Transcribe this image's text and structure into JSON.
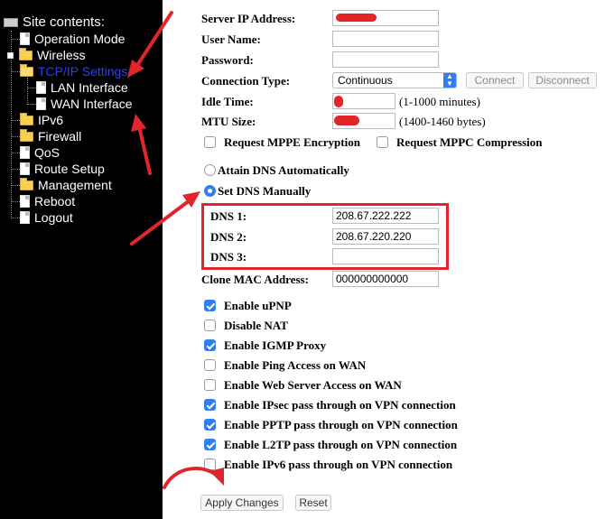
{
  "sidebar": {
    "title": "Site contents:",
    "items": [
      {
        "label": "Operation Mode"
      },
      {
        "label": "Wireless"
      },
      {
        "label": "TCP/IP Settings"
      },
      {
        "label": "LAN Interface"
      },
      {
        "label": "WAN Interface"
      },
      {
        "label": "IPv6"
      },
      {
        "label": "Firewall"
      },
      {
        "label": "QoS"
      },
      {
        "label": "Route Setup"
      },
      {
        "label": "Management"
      },
      {
        "label": "Reboot"
      },
      {
        "label": "Logout"
      }
    ],
    "active_color": "#2c3cff"
  },
  "form": {
    "server_ip_label": "Server IP Address:",
    "username_label": "User Name:",
    "password_label": "Password:",
    "connection_type_label": "Connection Type:",
    "connection_type_value": "Continuous",
    "connect_label": "Connect",
    "disconnect_label": "Disconnect",
    "idle_time_label": "Idle Time:",
    "idle_time_hint": "(1-1000 minutes)",
    "mtu_label": "MTU Size:",
    "mtu_hint": "(1400-1460 bytes)",
    "mppe_label": "Request MPPE Encryption",
    "mppc_label": "Request MPPC Compression",
    "dns_auto_label": "Attain DNS Automatically",
    "dns_manual_label": "Set DNS Manually",
    "dns1_label": "DNS 1:",
    "dns1_value": "208.67.222.222",
    "dns2_label": "DNS 2:",
    "dns2_value": "208.67.220.220",
    "dns3_label": "DNS 3:",
    "dns3_value": "",
    "clone_mac_label": "Clone MAC Address:",
    "clone_mac_value": "000000000000",
    "options": [
      {
        "label": "Enable uPNP",
        "checked": true
      },
      {
        "label": "Disable NAT",
        "checked": false
      },
      {
        "label": "Enable IGMP Proxy",
        "checked": true
      },
      {
        "label": "Enable Ping Access on WAN",
        "checked": false
      },
      {
        "label": "Enable Web Server Access on WAN",
        "checked": false
      },
      {
        "label": "Enable IPsec pass through on VPN connection",
        "checked": true
      },
      {
        "label": "Enable PPTP pass through on VPN connection",
        "checked": true
      },
      {
        "label": "Enable L2TP pass through on VPN connection",
        "checked": true
      },
      {
        "label": "Enable IPv6 pass through on VPN connection",
        "checked": false
      }
    ],
    "apply_label": "Apply Changes",
    "reset_label": "Reset"
  },
  "colors": {
    "accent": "#2f7ef6",
    "annotation": "#e0262b"
  }
}
